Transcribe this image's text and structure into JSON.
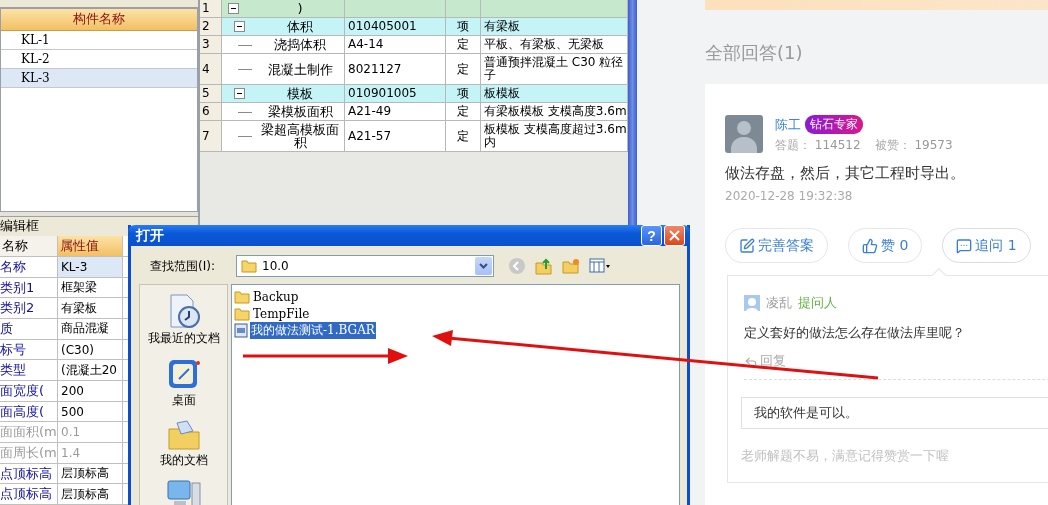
{
  "component_list": {
    "header": "构件名称",
    "rows": [
      {
        "name": "KL-1",
        "selected": false
      },
      {
        "name": "KL-2",
        "selected": false
      },
      {
        "name": "KL-3",
        "selected": true
      }
    ]
  },
  "property_editor": {
    "title": "编辑框",
    "columns": [
      "名称",
      "属性值"
    ],
    "rows": [
      {
        "name": "名称",
        "value": "KL-3",
        "selected": true,
        "disabled": false
      },
      {
        "name": "类别1",
        "value": "框架梁",
        "selected": false,
        "disabled": false
      },
      {
        "name": "类别2",
        "value": "有梁板",
        "selected": false,
        "disabled": false
      },
      {
        "name": "质",
        "value": "商品混凝",
        "selected": false,
        "disabled": false
      },
      {
        "name": "标号",
        "value": "(C30)",
        "selected": false,
        "disabled": false
      },
      {
        "name": "类型",
        "value": "(混凝土20",
        "selected": false,
        "disabled": false
      },
      {
        "name": "面宽度(",
        "value": "200",
        "selected": false,
        "disabled": false
      },
      {
        "name": "面高度(",
        "value": "500",
        "selected": false,
        "disabled": false
      },
      {
        "name": "面面积(m",
        "value": "0.1",
        "selected": false,
        "disabled": true
      },
      {
        "name": "面周长(m",
        "value": "1.4",
        "selected": false,
        "disabled": true
      },
      {
        "name": "点顶标高",
        "value": "层顶标高",
        "selected": false,
        "disabled": false
      },
      {
        "name": "点顶标高",
        "value": "层顶标高",
        "selected": false,
        "disabled": false
      }
    ]
  },
  "method_table": {
    "rows": [
      {
        "number": "1",
        "name": ")",
        "expanded": true,
        "children": [
          {
            "number": "2",
            "name": "体积",
            "code": "010405001",
            "type": "项",
            "description": "有梁板",
            "expanded": true,
            "children": [
              {
                "number": "3",
                "name": "浇捣体积",
                "code": "A4-14",
                "type": "定",
                "description": "平板、有梁板、无梁板"
              },
              {
                "number": "4",
                "name": "混凝土制作",
                "code": "8021127",
                "type": "定",
                "description": "普通预拌混凝土 C30 粒径子"
              }
            ]
          },
          {
            "number": "5",
            "name": "模板",
            "code": "010901005",
            "type": "项",
            "description": "板模板",
            "expanded": true,
            "children": [
              {
                "number": "6",
                "name": "梁模板面积",
                "code": "A21-49",
                "type": "定",
                "description": "有梁板模板 支模高度3.6m"
              },
              {
                "number": "7",
                "name": "梁超高模板面积",
                "code": "A21-57",
                "type": "定",
                "description": "板模板 支模高度超过3.6m内"
              }
            ]
          }
        ]
      }
    ]
  },
  "open_dialog": {
    "title": "打开",
    "help_button": "?",
    "look_in_label": "查找范围(I):",
    "look_in_value": "10.0",
    "places": [
      {
        "kind": "recent",
        "label": "我最近的文档"
      },
      {
        "kind": "desktop",
        "label": "桌面"
      },
      {
        "kind": "documents",
        "label": "我的文档"
      },
      {
        "kind": "computer"
      }
    ],
    "files": [
      {
        "kind": "folder",
        "name": "Backup",
        "selected": false
      },
      {
        "kind": "folder",
        "name": "TempFile",
        "selected": false
      },
      {
        "kind": "file",
        "name": "我的做法测试-1.BGAR",
        "selected": true
      }
    ]
  },
  "answers_heading": "全部回答(1)",
  "answer": {
    "author": "陈工",
    "badge": "钻石专家",
    "stats": [
      {
        "label": "答题：",
        "value": "114512"
      },
      {
        "label": "被赞：",
        "value": "19573"
      }
    ],
    "text": "做法存盘，然后，其它工程时导出。",
    "time": "2020-12-28 19:32:38",
    "actions": [
      {
        "kind": "edit",
        "label": "完善答案",
        "selected": false
      },
      {
        "kind": "like",
        "label": "赞 0",
        "selected": false
      },
      {
        "kind": "follow_up",
        "label": "追问 1",
        "selected": true
      }
    ],
    "follow_up": {
      "author": "凌乱",
      "role": "提问人",
      "question": "定义套好的做法怎么存在做法库里呢？",
      "reply_label": "回复",
      "reply_value": "我的软件是可以。",
      "hint": "老师解题不易，满意记得赞赏一下喔"
    }
  }
}
